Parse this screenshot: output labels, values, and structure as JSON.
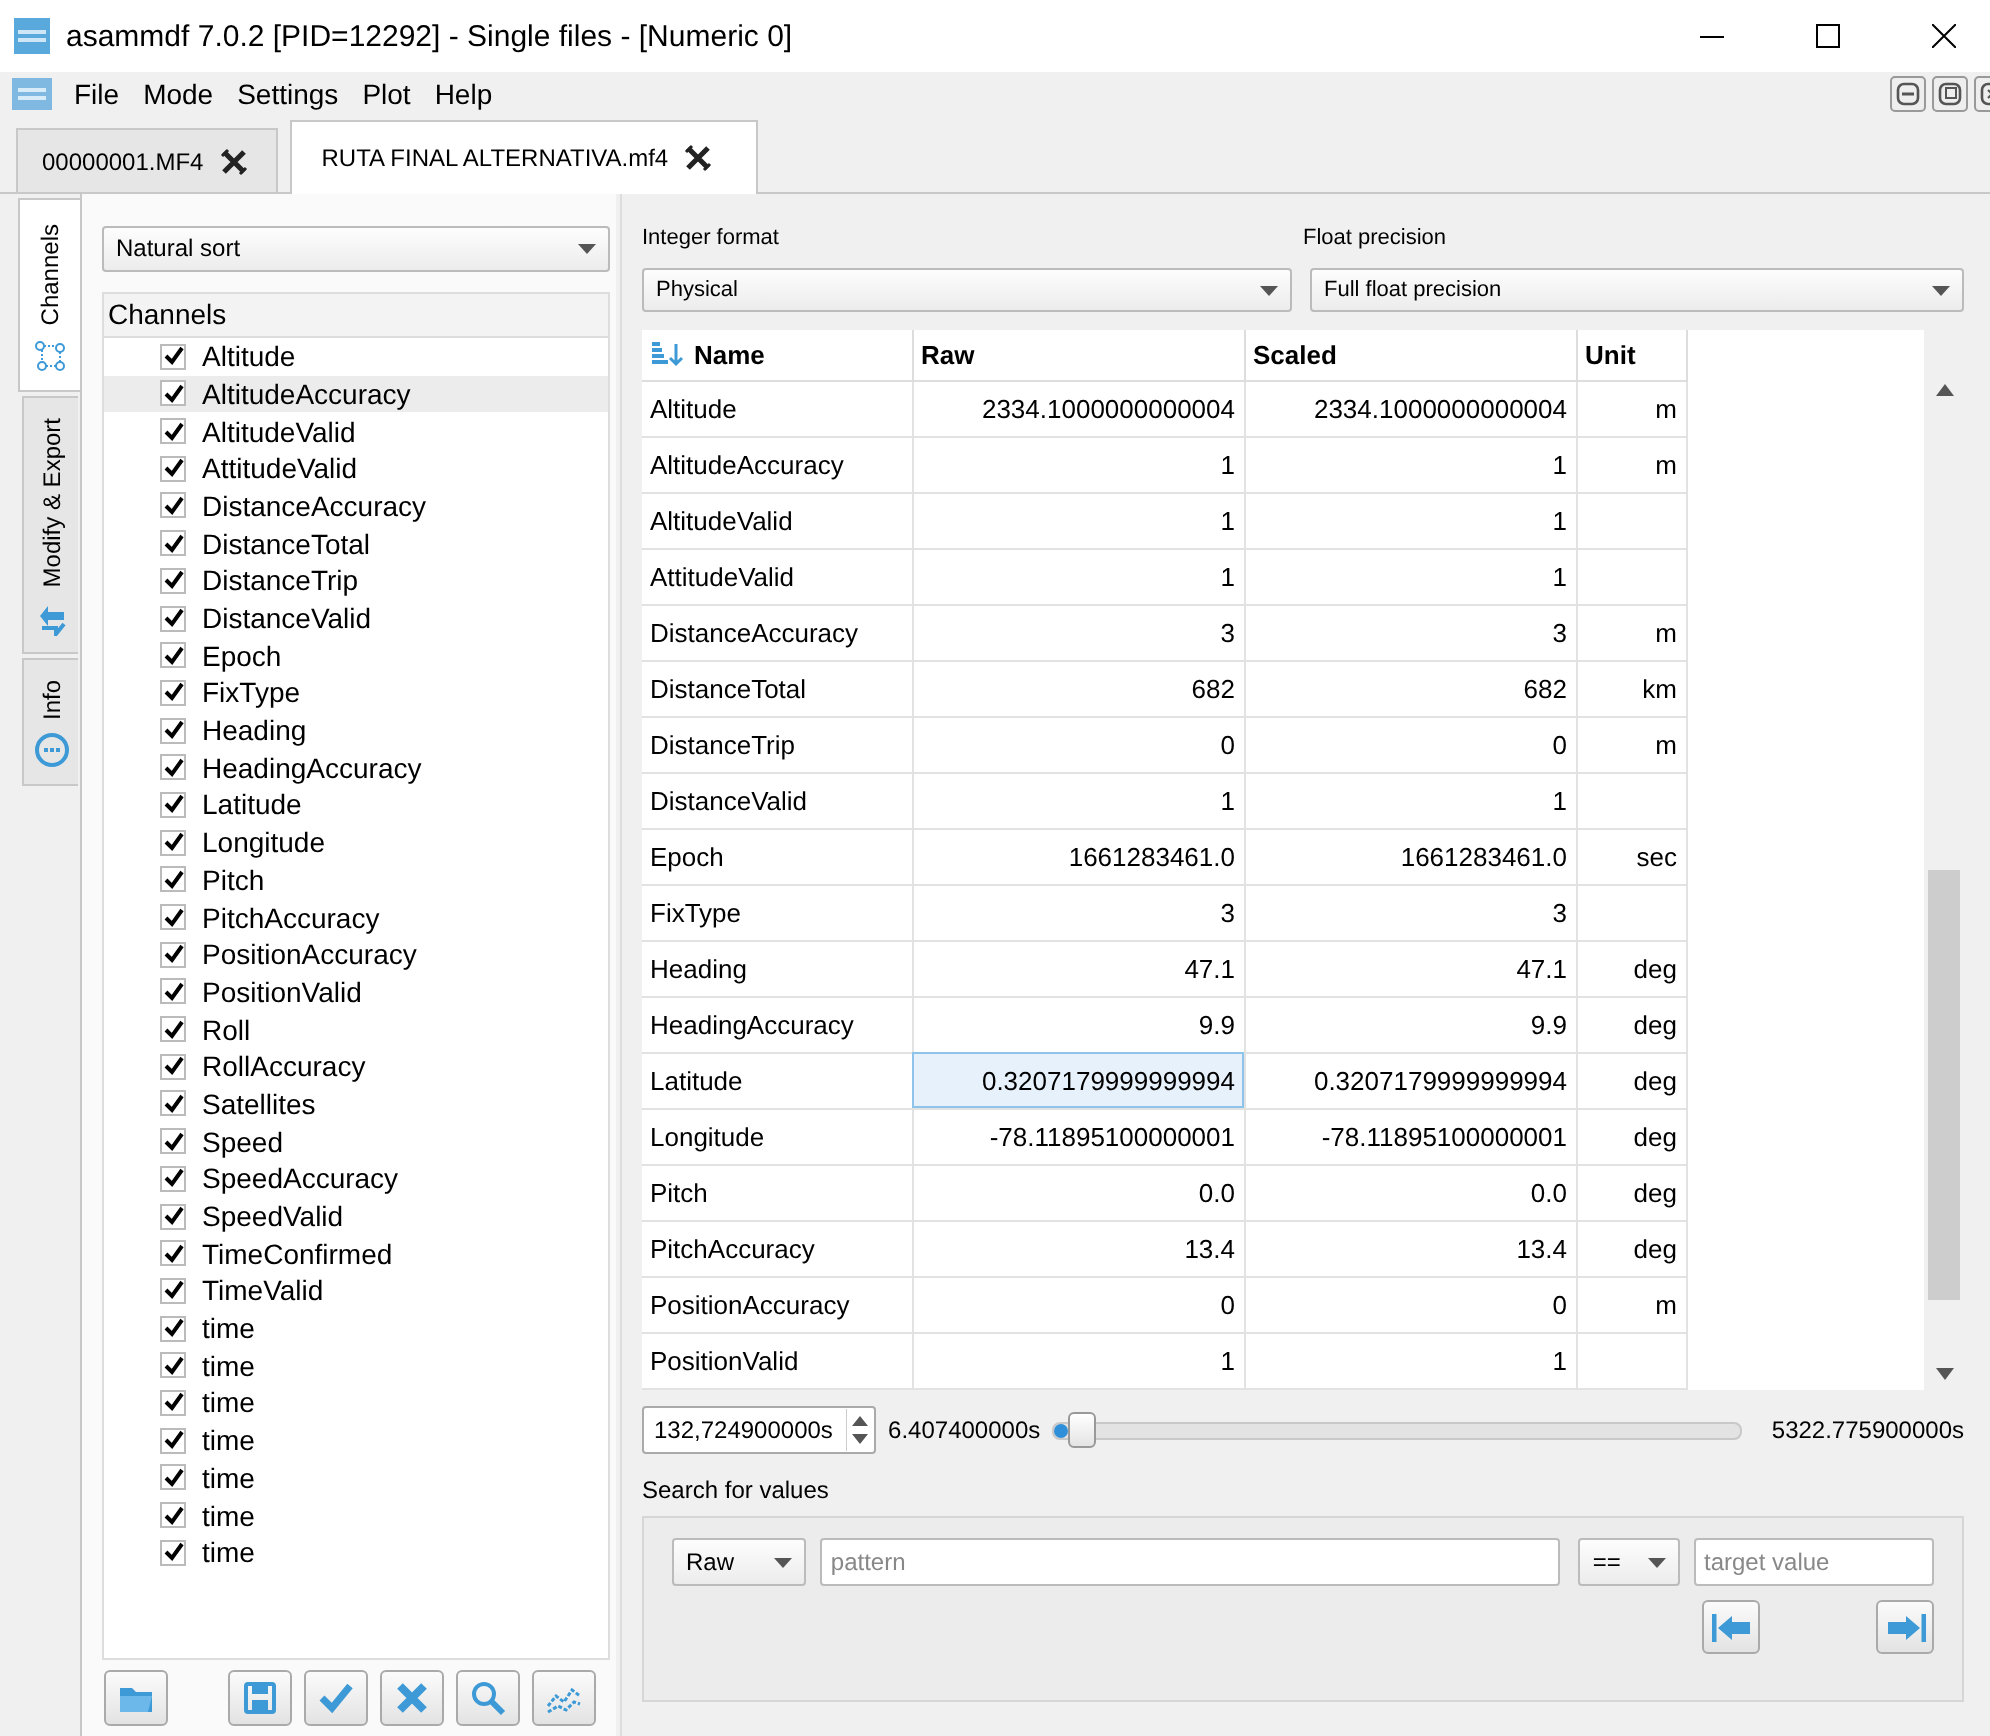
{
  "window": {
    "title": "asammdf 7.0.2 [PID=12292] - Single files - [Numeric 0]"
  },
  "menu": [
    "File",
    "Mode",
    "Settings",
    "Plot",
    "Help"
  ],
  "file_tabs": [
    {
      "label": "00000001.MF4",
      "selected": false
    },
    {
      "label": "RUTA FINAL ALTERNATIVA.mf4",
      "selected": true
    }
  ],
  "side_tabs": [
    {
      "label": "Channels",
      "kind": "channels",
      "selected": true
    },
    {
      "label": "Modify & Export",
      "kind": "modify",
      "selected": false
    },
    {
      "label": "Info",
      "kind": "info",
      "selected": false
    }
  ],
  "sort_combo": "Natural sort",
  "channels": {
    "header": "Channels",
    "items": [
      {
        "name": "Altitude",
        "checked": true,
        "selected": false
      },
      {
        "name": "AltitudeAccuracy",
        "checked": true,
        "selected": true
      },
      {
        "name": "AltitudeValid",
        "checked": true,
        "selected": false
      },
      {
        "name": "AttitudeValid",
        "checked": true,
        "selected": false
      },
      {
        "name": "DistanceAccuracy",
        "checked": true,
        "selected": false
      },
      {
        "name": "DistanceTotal",
        "checked": true,
        "selected": false
      },
      {
        "name": "DistanceTrip",
        "checked": true,
        "selected": false
      },
      {
        "name": "DistanceValid",
        "checked": true,
        "selected": false
      },
      {
        "name": "Epoch",
        "checked": true,
        "selected": false
      },
      {
        "name": "FixType",
        "checked": true,
        "selected": false
      },
      {
        "name": "Heading",
        "checked": true,
        "selected": false
      },
      {
        "name": "HeadingAccuracy",
        "checked": true,
        "selected": false
      },
      {
        "name": "Latitude",
        "checked": true,
        "selected": false
      },
      {
        "name": "Longitude",
        "checked": true,
        "selected": false
      },
      {
        "name": "Pitch",
        "checked": true,
        "selected": false
      },
      {
        "name": "PitchAccuracy",
        "checked": true,
        "selected": false
      },
      {
        "name": "PositionAccuracy",
        "checked": true,
        "selected": false
      },
      {
        "name": "PositionValid",
        "checked": true,
        "selected": false
      },
      {
        "name": "Roll",
        "checked": true,
        "selected": false
      },
      {
        "name": "RollAccuracy",
        "checked": true,
        "selected": false
      },
      {
        "name": "Satellites",
        "checked": true,
        "selected": false
      },
      {
        "name": "Speed",
        "checked": true,
        "selected": false
      },
      {
        "name": "SpeedAccuracy",
        "checked": true,
        "selected": false
      },
      {
        "name": "SpeedValid",
        "checked": true,
        "selected": false
      },
      {
        "name": "TimeConfirmed",
        "checked": true,
        "selected": false
      },
      {
        "name": "TimeValid",
        "checked": true,
        "selected": false
      },
      {
        "name": "time",
        "checked": true,
        "selected": false
      },
      {
        "name": "time",
        "checked": true,
        "selected": false
      },
      {
        "name": "time",
        "checked": true,
        "selected": false
      },
      {
        "name": "time",
        "checked": true,
        "selected": false
      },
      {
        "name": "time",
        "checked": true,
        "selected": false
      },
      {
        "name": "time",
        "checked": true,
        "selected": false
      },
      {
        "name": "time",
        "checked": true,
        "selected": false
      }
    ]
  },
  "bottom_buttons": [
    {
      "kind": "folder"
    },
    {
      "kind": "save"
    },
    {
      "kind": "check"
    },
    {
      "kind": "cross"
    },
    {
      "kind": "search"
    },
    {
      "kind": "plot"
    }
  ],
  "integer_format": {
    "label": "Integer format",
    "value": "Physical"
  },
  "float_precision": {
    "label": "Float precision",
    "value": "Full float precision"
  },
  "table": {
    "columns": [
      "Name",
      "Raw",
      "Scaled",
      "Unit"
    ],
    "rows": [
      {
        "name": "Altitude",
        "raw": "2334.1000000000004",
        "scaled": "2334.1000000000004",
        "unit": "m",
        "selected": false
      },
      {
        "name": "AltitudeAccuracy",
        "raw": "1",
        "scaled": "1",
        "unit": "m",
        "selected": false
      },
      {
        "name": "AltitudeValid",
        "raw": "1",
        "scaled": "1",
        "selected": false
      },
      {
        "name": "AttitudeValid",
        "raw": "1",
        "scaled": "1",
        "selected": false
      },
      {
        "name": "DistanceAccuracy",
        "raw": "3",
        "scaled": "3",
        "unit": "m",
        "selected": false
      },
      {
        "name": "DistanceTotal",
        "raw": "682",
        "scaled": "682",
        "unit": "km",
        "selected": false
      },
      {
        "name": "DistanceTrip",
        "raw": "0",
        "scaled": "0",
        "unit": "m",
        "selected": false
      },
      {
        "name": "DistanceValid",
        "raw": "1",
        "scaled": "1",
        "selected": false
      },
      {
        "name": "Epoch",
        "raw": "1661283461.0",
        "scaled": "1661283461.0",
        "unit": "sec",
        "selected": false
      },
      {
        "name": "FixType",
        "raw": "3",
        "scaled": "3",
        "selected": false
      },
      {
        "name": "Heading",
        "raw": "47.1",
        "scaled": "47.1",
        "unit": "deg",
        "selected": false
      },
      {
        "name": "HeadingAccuracy",
        "raw": "9.9",
        "scaled": "9.9",
        "unit": "deg",
        "selected": false
      },
      {
        "name": "Latitude",
        "raw": "0.3207179999999994",
        "scaled": "0.3207179999999994",
        "unit": "deg",
        "selected": true
      },
      {
        "name": "Longitude",
        "raw": "-78.11895100000001",
        "scaled": "-78.11895100000001",
        "unit": "deg",
        "selected": false
      },
      {
        "name": "Pitch",
        "raw": "0.0",
        "scaled": "0.0",
        "unit": "deg",
        "selected": false
      },
      {
        "name": "PitchAccuracy",
        "raw": "13.4",
        "scaled": "13.4",
        "unit": "deg",
        "selected": false
      },
      {
        "name": "PositionAccuracy",
        "raw": "0",
        "scaled": "0",
        "unit": "m",
        "selected": false
      },
      {
        "name": "PositionValid",
        "raw": "1",
        "scaled": "1",
        "selected": false
      }
    ]
  },
  "timestamp": {
    "value": "132,724900000s",
    "start": "6.407400000s",
    "end": "5322.775900000s",
    "level": 0.04
  },
  "search": {
    "label": "Search for values",
    "mode": "Raw",
    "pattern_placeholder": "pattern",
    "operator": "==",
    "target_placeholder": "target value"
  }
}
